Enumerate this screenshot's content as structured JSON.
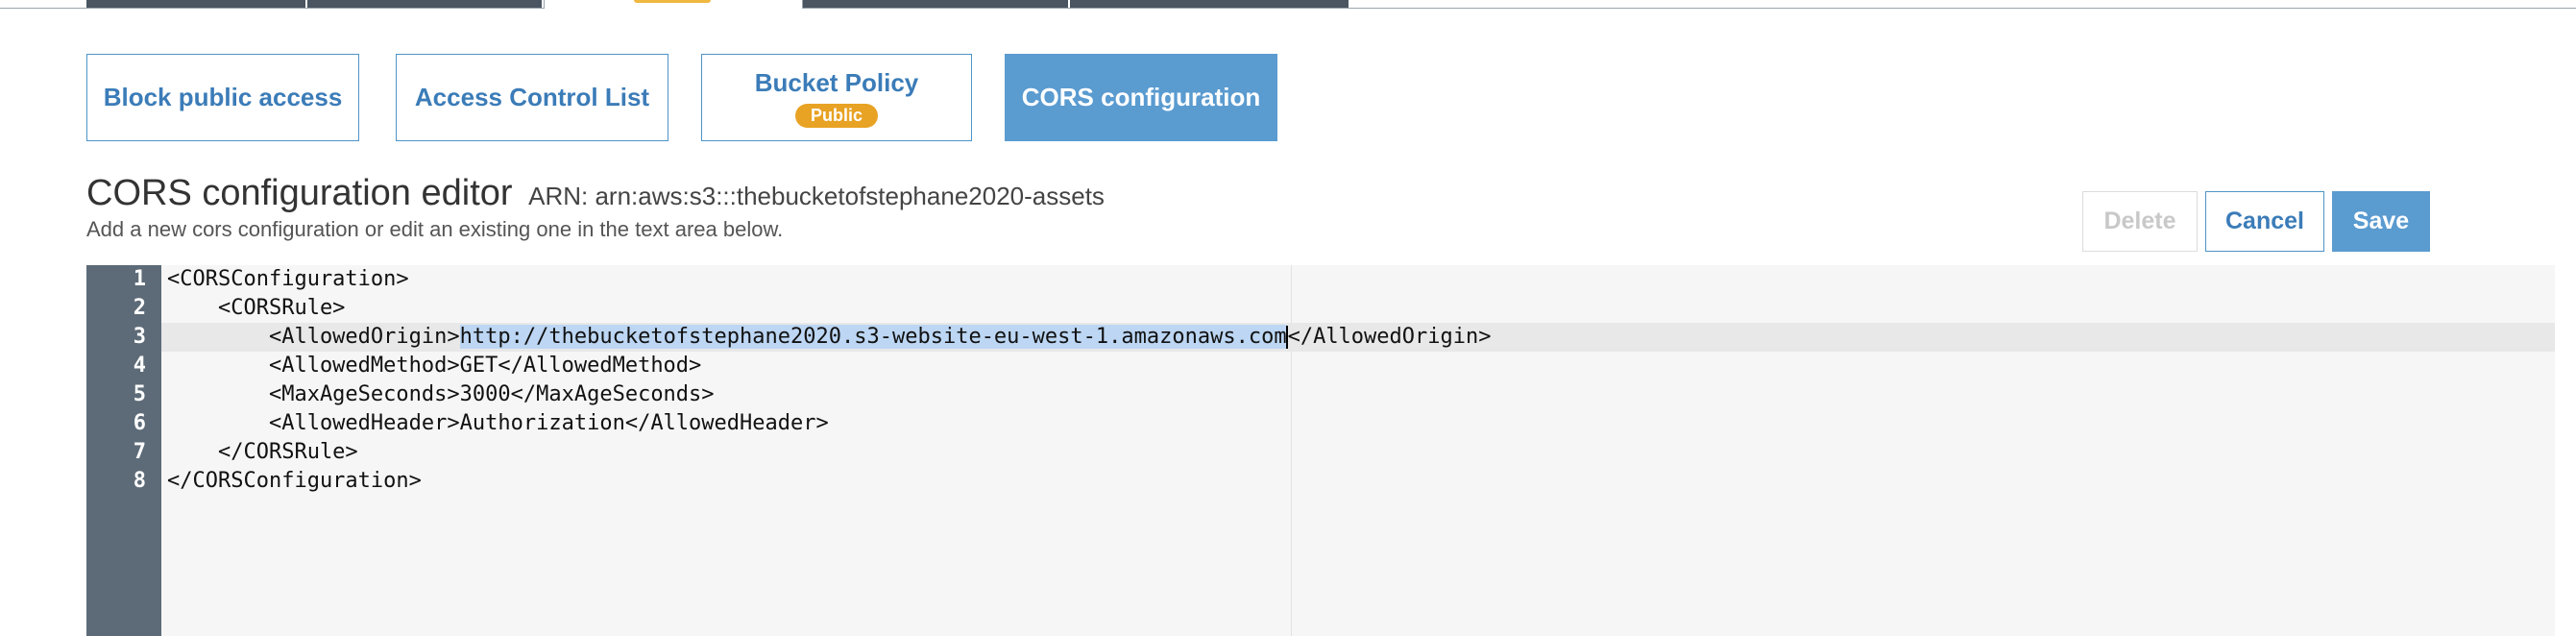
{
  "tabs": [
    {
      "label": "Block public access"
    },
    {
      "label": "Access Control List"
    },
    {
      "label": "Bucket Policy",
      "badge": "Public"
    },
    {
      "label": "CORS configuration",
      "active": true
    }
  ],
  "editor_header": {
    "title": "CORS configuration editor",
    "arn": "ARN: arn:aws:s3:::thebucketofstephane2020-assets",
    "subtitle": "Add a new cors configuration or edit an existing one in the text area below."
  },
  "buttons": {
    "delete_label": "Delete",
    "cancel_label": "Cancel",
    "save_label": "Save"
  },
  "code": {
    "line_numbers": [
      "1",
      "2",
      "3",
      "4",
      "5",
      "6",
      "7",
      "8"
    ],
    "line1": "<CORSConfiguration>",
    "line2": "    <CORSRule>",
    "line3_pre": "        <AllowedOrigin>",
    "line3_selected": "http://thebucketofstephane2020.s3-website-eu-west-1.amazonaws.com",
    "line3_post": "</AllowedOrigin>",
    "line4": "        <AllowedMethod>GET</AllowedMethod>",
    "line5": "        <MaxAgeSeconds>3000</MaxAgeSeconds>",
    "line6": "        <AllowedHeader>Authorization</AllowedHeader>",
    "line7": "    </CORSRule>",
    "line8": "</CORSConfiguration>"
  },
  "colors": {
    "accent": "#5a9bd0",
    "badge": "#e8a224",
    "gutter": "#5d6b78",
    "selection": "#bcd6f3"
  }
}
